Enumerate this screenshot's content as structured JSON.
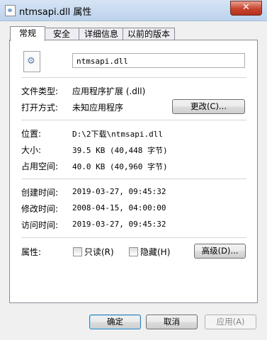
{
  "window": {
    "title": "ntmsapi.dll 属性",
    "close_glyph": "✕"
  },
  "tabs": [
    {
      "label": "常规",
      "active": true
    },
    {
      "label": "安全",
      "active": false
    },
    {
      "label": "详细信息",
      "active": false
    },
    {
      "label": "以前的版本",
      "active": false
    }
  ],
  "general": {
    "file_name": "ntmsapi.dll",
    "file_type_label": "文件类型:",
    "file_type_value": "应用程序扩展 (.dll)",
    "open_with_label": "打开方式:",
    "open_with_value": "未知应用程序",
    "change_button": "更改(C)...",
    "location_label": "位置:",
    "location_value": "D:\\2下载\\ntmsapi.dll",
    "size_label": "大小:",
    "size_value": "39.5 KB (40,448 字节)",
    "size_on_disk_label": "占用空间:",
    "size_on_disk_value": "40.0 KB (40,960 字节)",
    "created_label": "创建时间:",
    "created_value": "2019-03-27, 09:45:32",
    "modified_label": "修改时间:",
    "modified_value": "2008-04-15, 04:00:00",
    "accessed_label": "访问时间:",
    "accessed_value": "2019-03-27, 09:45:32",
    "attributes_label": "属性:",
    "readonly_label": "只读(R)",
    "readonly_checked": false,
    "hidden_label": "隐藏(H)",
    "hidden_checked": false,
    "advanced_button": "高级(D)..."
  },
  "footer": {
    "ok_button": "确定",
    "cancel_button": "取消",
    "apply_button": "应用(A)"
  }
}
